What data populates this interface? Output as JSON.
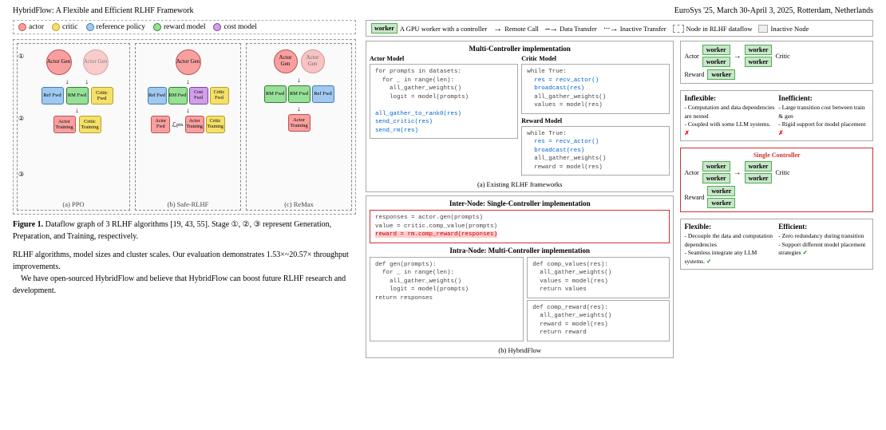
{
  "header": {
    "left": "HybridFlow: A Flexible and Efficient RLHF Framework",
    "right": "EuroSys '25, March 30-April 3, 2025, Rotterdam, Netherlands"
  },
  "legend": {
    "items": [
      {
        "label": "actor",
        "color": "actor"
      },
      {
        "label": "critic",
        "color": "critic"
      },
      {
        "label": "reference policy",
        "color": "refpol"
      },
      {
        "label": "reward model",
        "color": "reward"
      },
      {
        "label": "cost model",
        "color": "cost"
      }
    ]
  },
  "caption": {
    "text": "Figure 1. Dataflow graph of 3 RLHF algorithms [19, 43, 55]. Stage ①, ②, ③ represent Generation, Preparation, and Training, respectively."
  },
  "body": {
    "para1": "RLHF algorithms, model sizes and cluster scales. Our evaluation demonstrates 1.53×~20.57× throughput improvements.",
    "para2": "We have open-sourced HybridFlow and believe that HybridFlow can boost future RLHF research and development."
  },
  "right_panel": {
    "legend": {
      "worker_label": "worker",
      "worker_desc": "A GPU worker with a controller",
      "remote_call": "Remote Call",
      "data_transfer": "Data Transfer",
      "inactive_transfer": "Inactive Transfer",
      "rlhf_dataflow": "Node in RLHF dataflow",
      "inactive_node": "Inactive Node"
    },
    "existing": {
      "title": "Multi-Controller implementation",
      "critic_model_title": "Critic Model",
      "actor_model_title": "Actor Model",
      "actor_code": "for prompts in datasets:\n    for _ in range(len):\n        all_gather_weights()\n        logit = model(prompts)\n\nall_gather_to_rank0(res)\nsend_critic(res)\nsend_rm(res)",
      "critic_code": "while True:\n    res = recv_actor()\n    broadcast(res)\n    all_gather_weights()\n    values = model(res)",
      "reward_model_title": "Reward Model",
      "reward_code": "while True:\n    res = recv_actor()\n    broadcast(res)\n    all_gather_weights()\n    reward = model(res)",
      "label": "(a) Existing RLHF frameworks"
    },
    "inflexible": {
      "title_left": "Inflexible:",
      "items_left": [
        "- Computation and data dependencies are nested",
        "- Coupled with some LLM systems."
      ],
      "title_right": "Inefficient:",
      "items_right": [
        "- Large transition cost between train & gen",
        "- Rigid support for model placement"
      ]
    },
    "hybridflow": {
      "inter_title": "Inter-Node: Single-Controller implementation",
      "inter_code": "responses = actor.gen(prompts)\nvalue = critic.comp_value(prompts)\nreward = rm.comp_reward(responses)",
      "intra_title": "Intra-Node: Multi-Controller implementation",
      "gen_code": "def gen(prompts):\n    for _ in range(len):\n        all_gather_weights()\n        logit = model(prompts)\n    return responses",
      "comp_reward_code": "def comp_reward(res):\n    all_gather_weights()\n    reward = model(res)\n    return reward",
      "comp_values_code": "def comp_values(res):\n    all_gather_weights()\n    values = model(res)\n    return values",
      "label": "(b) HybridFlow"
    },
    "flexible": {
      "title_left": "Flexible:",
      "items_left": [
        "- Decouple the data and computation dependencies",
        "- Seamless integrate any LLM systems."
      ],
      "title_right": "Efficient:",
      "items_right": [
        "- Zero redundancy during transition",
        "- Support different model placement strategies"
      ]
    }
  }
}
